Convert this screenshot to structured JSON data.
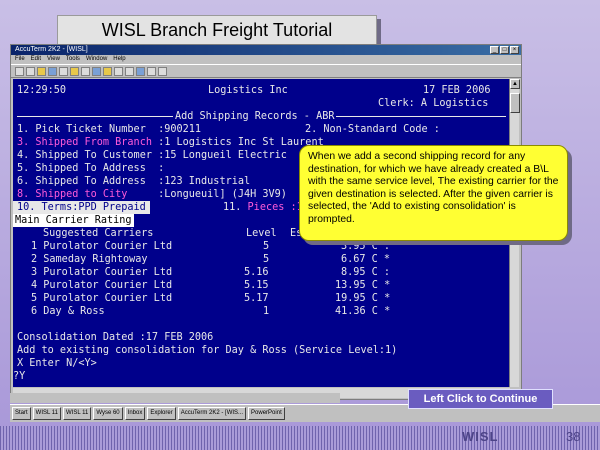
{
  "slide": {
    "title": "WISL Branch Freight Tutorial",
    "callout": "When we add a second shipping record for any destination, for which we have already created a B\\L with the same service level, The existing carrier for the given destination is selected. After the given carrier is selected, the 'Add to existing consolidation' is prompted.",
    "continue_label": "Left Click to Continue",
    "logo": "WISL",
    "page_number": "38"
  },
  "window": {
    "title": "AccuTerm 2K2 - [WISL]",
    "menu": [
      "File",
      "Edit",
      "View",
      "Tools",
      "Window",
      "Help"
    ]
  },
  "terminal": {
    "time": "12:29:50",
    "company": "Logistics Inc",
    "date": "17 FEB 2006",
    "clerk": "Clerk: A Logistics",
    "screen_title": "Add Shipping Records - ABR",
    "fields": [
      {
        "num": "1.",
        "label": "Pick Ticket Number",
        "value": ":900211",
        "highlight": false
      },
      {
        "num": "3.",
        "label": "Shipped From Branch",
        "value": ":1 Logistics Inc St Laurent",
        "highlight": true
      },
      {
        "num": "4.",
        "label": "Shipped To Customer",
        "value": ":15 Longueil Electric",
        "highlight": false
      },
      {
        "num": "5.",
        "label": "Shipped To Address",
        "value": ":",
        "highlight": false
      },
      {
        "num": "6.",
        "label": "Shipped To Address",
        "value": ":123 Industrial",
        "highlight": false
      },
      {
        "num": "8.",
        "label": "Shipped to City",
        "value": ":Longueuil] (J4H 3V9)",
        "highlight": true
      }
    ],
    "nonstd_label": "2. Non-Standard Code :",
    "terms": "10. Terms:PPD Prepaid",
    "pieces_num": "11.",
    "pieces_label": "Pieces :1",
    "main_carrier": "Main Carrier Rating",
    "header": {
      "carriers": "Suggested Carriers",
      "level": "Level",
      "est": "Est"
    },
    "carriers": [
      {
        "n": "1",
        "name": "Purolator Courier Ltd",
        "level": "5",
        "cost": "3.95 C :"
      },
      {
        "n": "2",
        "name": "Sameday Rightoway",
        "level": "5",
        "cost": "6.67 C *"
      },
      {
        "n": "3",
        "name": "Purolator Courier Ltd",
        "level": "5.16",
        "cost": "8.95 C :"
      },
      {
        "n": "4",
        "name": "Purolator Courier Ltd",
        "level": "5.15",
        "cost": "13.95 C *"
      },
      {
        "n": "5",
        "name": "Purolator Courier Ltd",
        "level": "5.17",
        "cost": "19.95 C *"
      },
      {
        "n": "6",
        "name": "Day & Ross",
        "level": "1",
        "cost": "41.36 C *"
      }
    ],
    "consolidation": "Consolidation Dated :17 FEB 2006",
    "add_existing": "Add to existing consolidation for Day & Ross (Service Level:1)",
    "prompt1": "X Enter N/<Y>",
    "prompt2": "?Y"
  },
  "taskbar": [
    "Start",
    "WISL 11",
    "WISL 11",
    "Wyse 60",
    "Inbox",
    "Explorer",
    "AccuTerm 2K2 - [WIS...",
    "PowerPoint"
  ]
}
